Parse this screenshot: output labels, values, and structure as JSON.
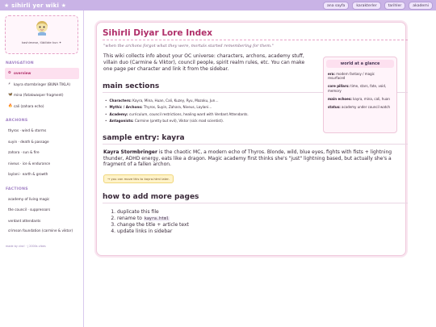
{
  "header": {
    "site_title": "★ sihirli yer wiki ★",
    "nav": [
      "ana sayfa",
      "karakterler",
      "tarihler",
      "akademi"
    ]
  },
  "profile": {
    "caption": "kashimese, lüblibte kun ✦"
  },
  "sidebar": {
    "nav_heading": "NAVIGATION",
    "nav_items": [
      {
        "icon": "✿",
        "label": "overview"
      },
      {
        "icon": "⚡",
        "label": "kayra stormbringer (BUNA TIKLA)"
      },
      {
        "icon": "🦋",
        "label": "mina (fatakwasper fragment)"
      },
      {
        "icon": "🔥",
        "label": "cali (zahara echo)"
      }
    ],
    "archons_heading": "ARCHONS",
    "archons": [
      "thyros · wind & storms",
      "suyin · death & passage",
      "zahara · sun & fire",
      "niveus · ice & endurance",
      "laylani · earth & growth"
    ],
    "factions_heading": "FACTIONS",
    "factions": [
      "academy of living magic",
      "the council · suppressors",
      "verdant attendants",
      "crimson foundation (carmine & viktor)"
    ],
    "footer": "made by vira! ·  | 2000s vibes"
  },
  "main": {
    "title": "Sihirli Diyar Lore Index",
    "quote": "\"when the archons forgot what they were, mortals started remembering for them.\"",
    "intro": "This wiki collects info about your OC universe: characters, archons, academy stuff, villain duo (Carmine & Viktor), council people, spirit realm rules, etc. You can make one page per character and link it from the sidebar.",
    "infobox": {
      "title": "world at a glance",
      "rows": [
        {
          "key": "era:",
          "value": "modern fantasy / magic resurfaced"
        },
        {
          "key": "core pillars:",
          "value": "time, stars, fate, void, memory"
        },
        {
          "key": "main echoes:",
          "value": "kayra, mina, cali, huan"
        },
        {
          "key": "status:",
          "value": "academy under council watch"
        }
      ]
    },
    "sections_heading": "main sections",
    "bullets": [
      {
        "label": "Characters:",
        "text": "Kayra, Mina, Huan, Cali, Kuzey, Ryu, Mazoku, Jun…"
      },
      {
        "label": "Mythic / Archons:",
        "text": "Thyros, Suyin, Zahara, Niveus, Laylani…"
      },
      {
        "label": "Academy:",
        "text": "curriculum, council restrictions, healing ward with Verdant Attendants."
      },
      {
        "label": "Antagonists:",
        "text": "Carmine (pretty but evil), Viktor (sick mad scientist)."
      }
    ],
    "sample_heading": "sample entry: kayra",
    "sample_name": "Kayra Stormbringer",
    "sample_text": " is the chaotic MC, a modern echo of Thyros. Blonde, wild, blue eyes, fights with fists + lightning thunder, ADHD energy, eats like a dragon. Magic academy first thinks she's \"just\" lightning based, but actually she's a fragment of a fallen archon.",
    "sample_note": "→ you can move this to kayra.html later.",
    "howto_heading": "how to add more pages",
    "steps": [
      {
        "before": "duplicate this file",
        "code": "",
        "after": ""
      },
      {
        "before": "rename to ",
        "code": "kayra.html",
        "after": ""
      },
      {
        "before": "change the title + article text",
        "code": "",
        "after": ""
      },
      {
        "before": "update links in sidebar",
        "code": "",
        "after": ""
      }
    ]
  },
  "colors": {
    "accent": "#b0306a",
    "topbar": "#c9b3e6",
    "pink_bg": "#fde0ef"
  }
}
